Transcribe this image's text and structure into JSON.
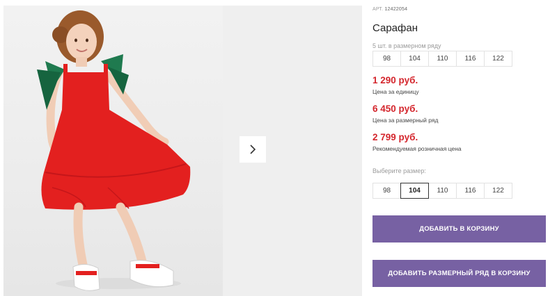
{
  "gallery": {
    "next_icon": "chevron-right-icon"
  },
  "product": {
    "article_prefix": "АРТ.",
    "article_number": "12422054",
    "title": "Сарафан",
    "pack_label": "5 шт. в размерном ряду",
    "pack_sizes": [
      "98",
      "104",
      "110",
      "116",
      "122"
    ],
    "prices": [
      {
        "value": "1 290 руб.",
        "note": "Цена за единицу"
      },
      {
        "value": "6 450 руб.",
        "note": "Цена за размерный ряд"
      },
      {
        "value": "2 799 руб.",
        "note": "Рекомендуемая розничная цена"
      }
    ],
    "choose_size_label": "Выберите размер:",
    "sizes": [
      "98",
      "104",
      "110",
      "116",
      "122"
    ],
    "selected_size": "104"
  },
  "actions": {
    "add_to_cart": "ДОБАВИТЬ В КОРЗИНУ",
    "add_set_to_cart": "ДОБАВИТЬ РАЗМЕРНЫЙ РЯД В КОРЗИНУ"
  },
  "colors": {
    "price": "#d4262d",
    "button": "#7761a3",
    "dress": "#e3201f",
    "bow": "#1f7a4f"
  }
}
